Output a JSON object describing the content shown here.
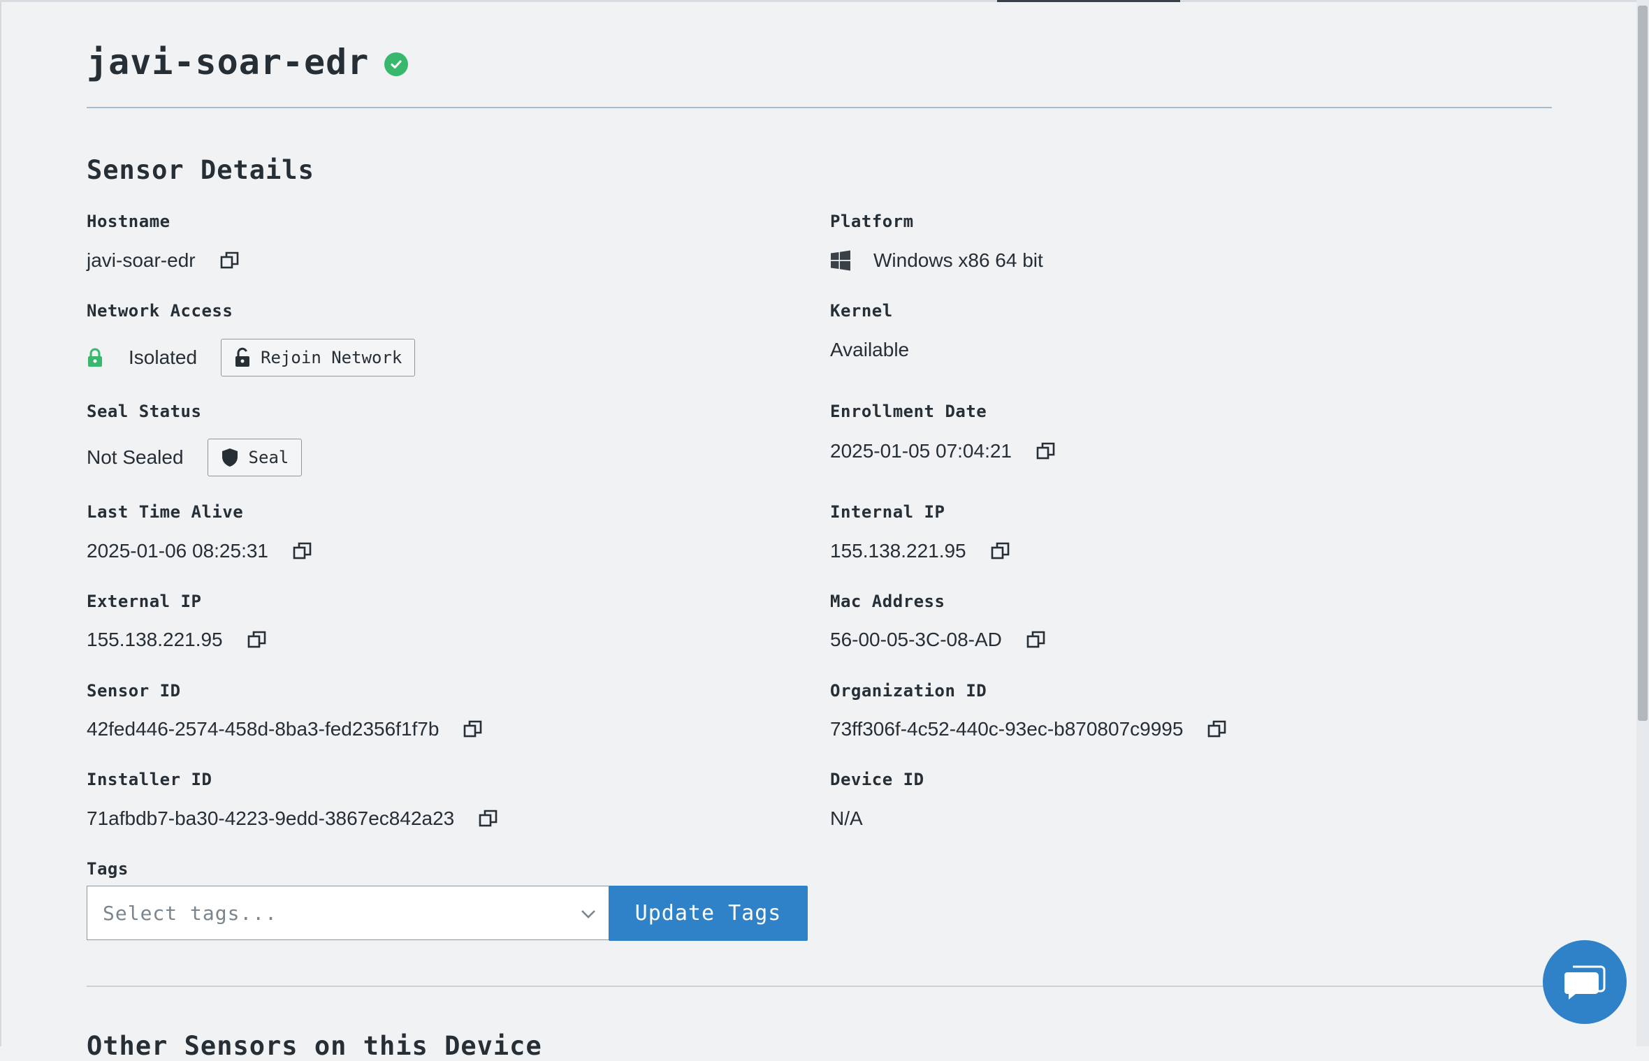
{
  "header": {
    "title": "javi-soar-edr",
    "status_icon": "check-circle-icon",
    "status_color": "#37b86c"
  },
  "section": {
    "title": "Sensor Details"
  },
  "fields": {
    "hostname": {
      "label": "Hostname",
      "value": "javi-soar-edr"
    },
    "platform": {
      "label": "Platform",
      "value": "Windows x86 64 bit",
      "icon": "windows-icon"
    },
    "network_access": {
      "label": "Network Access",
      "value": "Isolated",
      "icon": "lock-icon",
      "icon_color": "#37b86c",
      "button": "Rejoin Network"
    },
    "kernel": {
      "label": "Kernel",
      "value": "Available"
    },
    "seal_status": {
      "label": "Seal Status",
      "value": "Not Sealed",
      "button": "Seal"
    },
    "enrollment_date": {
      "label": "Enrollment Date",
      "value": "2025-01-05 07:04:21"
    },
    "last_time_alive": {
      "label": "Last Time Alive",
      "value": "2025-01-06 08:25:31"
    },
    "internal_ip": {
      "label": "Internal IP",
      "value": "155.138.221.95"
    },
    "external_ip": {
      "label": "External IP",
      "value": "155.138.221.95"
    },
    "mac_address": {
      "label": "Mac Address",
      "value": "56-00-05-3C-08-AD"
    },
    "sensor_id": {
      "label": "Sensor ID",
      "value": "42fed446-2574-458d-8ba3-fed2356f1f7b"
    },
    "organization_id": {
      "label": "Organization ID",
      "value": "73ff306f-4c52-440c-93ec-b870807c9995"
    },
    "installer_id": {
      "label": "Installer ID",
      "value": "71afbdb7-ba30-4223-9edd-3867ec842a23"
    },
    "device_id": {
      "label": "Device ID",
      "value": "N/A"
    }
  },
  "tags": {
    "label": "Tags",
    "placeholder": "Select tags...",
    "button": "Update Tags"
  },
  "next_section": {
    "title": "Other Sensors on this Device"
  },
  "colors": {
    "primary": "#2f82c8",
    "success": "#37b86c",
    "background": "#f0f2f4"
  }
}
